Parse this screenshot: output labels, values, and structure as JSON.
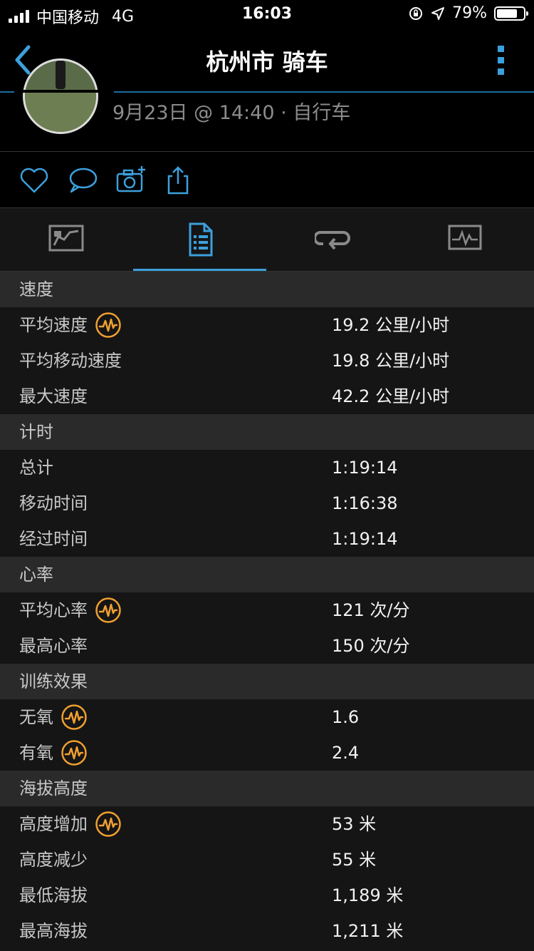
{
  "status_bar": {
    "carrier": "中国移动",
    "network": "4G",
    "time": "16:03",
    "battery_percent": "79%",
    "battery_level": 0.79
  },
  "nav": {
    "title": "杭州市 骑车"
  },
  "activity": {
    "meta": "9月23日 @ 14:40 · 自行车"
  },
  "colors": {
    "accent": "#3ca0dc",
    "badge": "#f0a030",
    "section_bg": "#2a2a2a",
    "row_bg": "#151515"
  },
  "sections": [
    {
      "title": "速度",
      "rows": [
        {
          "label": "平均速度",
          "value": "19.2 公里/小时",
          "icon": "heart-rate-badge-icon"
        },
        {
          "label": "平均移动速度",
          "value": "19.8 公里/小时"
        },
        {
          "label": "最大速度",
          "value": "42.2 公里/小时"
        }
      ]
    },
    {
      "title": "计时",
      "rows": [
        {
          "label": "总计",
          "value": "1:19:14"
        },
        {
          "label": "移动时间",
          "value": "1:16:38"
        },
        {
          "label": "经过时间",
          "value": "1:19:14"
        }
      ]
    },
    {
      "title": "心率",
      "rows": [
        {
          "label": "平均心率",
          "value": "121 次/分",
          "icon": "heart-rate-badge-icon"
        },
        {
          "label": "最高心率",
          "value": "150 次/分"
        }
      ]
    },
    {
      "title": "训练效果",
      "rows": [
        {
          "label": "无氧",
          "value": "1.6",
          "icon": "heart-rate-badge-icon"
        },
        {
          "label": "有氧",
          "value": "2.4",
          "icon": "heart-rate-badge-icon"
        }
      ]
    },
    {
      "title": "海拔高度",
      "rows": [
        {
          "label": "高度增加",
          "value": "53 米",
          "icon": "heart-rate-badge-icon"
        },
        {
          "label": "高度减少",
          "value": "55 米"
        },
        {
          "label": "最低海拔",
          "value": "1,189 米"
        },
        {
          "label": "最高海拔",
          "value": "1,211 米"
        }
      ]
    }
  ]
}
